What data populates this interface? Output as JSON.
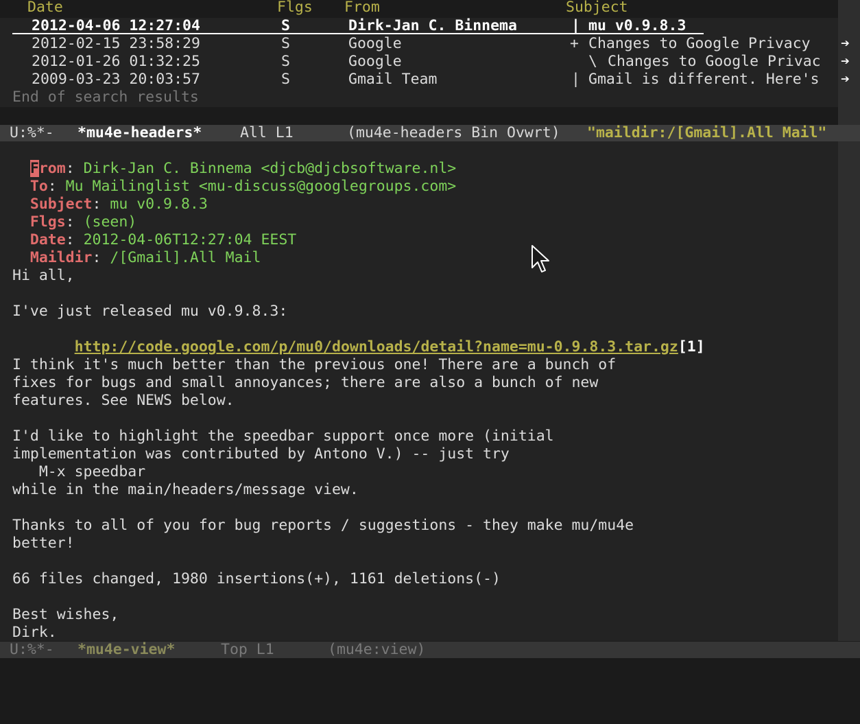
{
  "headers": {
    "columns": {
      "date": "Date",
      "flags": "Flgs",
      "from": "From",
      "subject": "Subject"
    },
    "rows": [
      {
        "date": "2012-04-06 12:27:04",
        "flags": "S",
        "from": "Dirk-Jan C. Binnema",
        "thread": "|",
        "subject": "mu v0.9.8.3",
        "selected": true
      },
      {
        "date": "2012-02-15 23:58:29",
        "flags": "S",
        "from": "Google",
        "thread": "+",
        "subject": "Changes to Google Privacy",
        "truncated": "➔"
      },
      {
        "date": "2012-01-26 01:32:25",
        "flags": "S",
        "from": "Google",
        "thread": "\\",
        "subject": "Changes to Google Privac",
        "truncated": "➔"
      },
      {
        "date": "2009-03-23 20:03:57",
        "flags": "S",
        "from": "Gmail Team",
        "thread": "|",
        "subject": "Gmail is different. Here's",
        "truncated": "➔"
      }
    ],
    "end_text": "End of search results"
  },
  "modeline_headers": {
    "status": "U:%*-",
    "buffer": "*mu4e-headers*",
    "position": "All L1",
    "modes": "(mu4e-headers Bin Ovwrt)",
    "query": "\"maildir:/[Gmail].All Mail\""
  },
  "message": {
    "fields": [
      {
        "name": "From",
        "value": "Dirk-Jan C. Binnema <djcb@djcbsoftware.nl>"
      },
      {
        "name": "To",
        "value": "Mu Mailinglist <mu-discuss@googlegroups.com>"
      },
      {
        "name": "Subject",
        "value": "mu v0.9.8.3"
      },
      {
        "name": "Flgs",
        "value": "(seen)"
      },
      {
        "name": "Date",
        "value": "2012-04-06T12:27:04 EEST"
      },
      {
        "name": "Maildir",
        "value": "/[Gmail].All Mail"
      }
    ],
    "body": {
      "l1": "Hi all,",
      "l2": "I've just released mu v0.9.8.3:",
      "link_indent": "     ",
      "link": "http://code.google.com/p/mu0/downloads/detail?name=mu-0.9.8.3.tar.gz",
      "link_ref": "[1]",
      "l3": "I think it's much better than the previous one! There are a bunch of",
      "l4": "fixes for bugs and small annoyances; there are also a bunch of new",
      "l5": "features. See NEWS below.",
      "l6": "I'd like to highlight the speedbar support once more (initial",
      "l7": "implementation was contributed by Antono V.) -- just try",
      "l8": "   M-x speedbar",
      "l9": "while in the main/headers/message view.",
      "l10": "Thanks to all of you for bug reports / suggestions - they make mu/mu4e",
      "l11": "better!",
      "l12": "66 files changed, 1980 insertions(+), 1161 deletions(-)",
      "l13": "Best wishes,",
      "l14": "Dirk."
    }
  },
  "modeline_view": {
    "status": "U:%*-",
    "buffer": "*mu4e-view*",
    "position": "Top L1",
    "modes": "(mu4e:view)"
  },
  "colors": {
    "background": "#1b1b1b",
    "header_label": "#b9b34a",
    "field_name": "#e06c6c",
    "field_value": "#7fd35a",
    "link": "#b8b24a"
  }
}
